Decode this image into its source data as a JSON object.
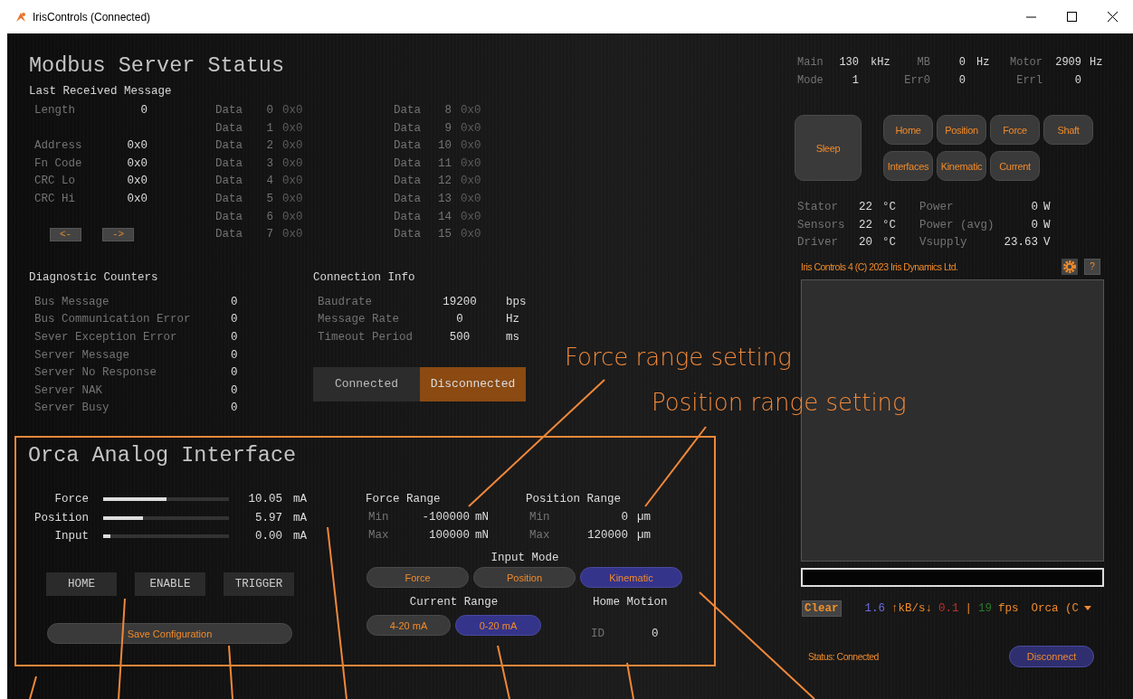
{
  "window": {
    "title": "IrisControls (Connected)"
  },
  "modbus": {
    "title": "Modbus Server Status",
    "last_message": {
      "heading": "Last Received Message",
      "length": {
        "label": "Length",
        "value": "0"
      },
      "fields": [
        {
          "label": "Address",
          "value": "0x0"
        },
        {
          "label": "Fn Code",
          "value": "0x0"
        },
        {
          "label": "CRC Lo",
          "value": "0x0"
        },
        {
          "label": "CRC Hi",
          "value": "0x0"
        }
      ],
      "nav_buttons": [
        "<-",
        "->"
      ],
      "data": [
        {
          "label": "Data",
          "index": "0",
          "value": "0x0"
        },
        {
          "label": "Data",
          "index": "1",
          "value": "0x0"
        },
        {
          "label": "Data",
          "index": "2",
          "value": "0x0"
        },
        {
          "label": "Data",
          "index": "3",
          "value": "0x0"
        },
        {
          "label": "Data",
          "index": "4",
          "value": "0x0"
        },
        {
          "label": "Data",
          "index": "5",
          "value": "0x0"
        },
        {
          "label": "Data",
          "index": "6",
          "value": "0x0"
        },
        {
          "label": "Data",
          "index": "7",
          "value": "0x0"
        },
        {
          "label": "Data",
          "index": "8",
          "value": "0x0"
        },
        {
          "label": "Data",
          "index": "9",
          "value": "0x0"
        },
        {
          "label": "Data",
          "index": "10",
          "value": "0x0"
        },
        {
          "label": "Data",
          "index": "11",
          "value": "0x0"
        },
        {
          "label": "Data",
          "index": "12",
          "value": "0x0"
        },
        {
          "label": "Data",
          "index": "13",
          "value": "0x0"
        },
        {
          "label": "Data",
          "index": "14",
          "value": "0x0"
        },
        {
          "label": "Data",
          "index": "15",
          "value": "0x0"
        }
      ]
    },
    "diagnostics": {
      "heading": "Diagnostic Counters",
      "rows": [
        {
          "label": "Bus Message",
          "value": "0"
        },
        {
          "label": "Bus Communication Error",
          "value": "0"
        },
        {
          "label": "Sever Exception Error",
          "value": "0"
        },
        {
          "label": "Server Message",
          "value": "0"
        },
        {
          "label": "Server No Response",
          "value": "0"
        },
        {
          "label": "Server NAK",
          "value": "0"
        },
        {
          "label": "Server Busy",
          "value": "0"
        }
      ]
    },
    "connection": {
      "heading": "Connection Info",
      "rows": [
        {
          "label": "Baudrate",
          "value": "19200",
          "unit": "bps"
        },
        {
          "label": "Message Rate",
          "value": "0",
          "unit": "Hz"
        },
        {
          "label": "Timeout Period",
          "value": "500",
          "unit": "ms"
        }
      ],
      "toggle": [
        {
          "label": "Connected",
          "selected": false
        },
        {
          "label": "Disconnected",
          "selected": true
        }
      ]
    }
  },
  "analog": {
    "title": "Orca Analog Interface",
    "signals": [
      {
        "label": "Force",
        "level": 0.5,
        "value": "10.05",
        "unit": "mA"
      },
      {
        "label": "Position",
        "level": 0.32,
        "value": "5.97",
        "unit": "mA"
      },
      {
        "label": "Input",
        "level": 0.06,
        "value": "0.00",
        "unit": "mA"
      }
    ],
    "buttons": [
      "HOME",
      "ENABLE",
      "TRIGGER"
    ],
    "save": "Save Configuration",
    "force_range": {
      "heading": "Force Range",
      "rows": [
        {
          "label": "Min",
          "value": "-100000",
          "unit": "mN"
        },
        {
          "label": "Max",
          "value": "100000",
          "unit": "mN"
        }
      ]
    },
    "position_range": {
      "heading": "Position Range",
      "rows": [
        {
          "label": "Min",
          "value": "0",
          "unit": "µm"
        },
        {
          "label": "Max",
          "value": "120000",
          "unit": "µm"
        }
      ]
    },
    "input_mode": {
      "heading": "Input Mode",
      "options": [
        {
          "label": "Force",
          "selected": false
        },
        {
          "label": "Position",
          "selected": false
        },
        {
          "label": "Kinematic",
          "selected": true
        }
      ]
    },
    "current_range": {
      "heading": "Current Range",
      "options": [
        {
          "label": "4-20 mA",
          "selected": false
        },
        {
          "label": "0-20 mA",
          "selected": true
        }
      ]
    },
    "home_motion": {
      "heading": "Home Motion",
      "label": "ID",
      "value": "0"
    }
  },
  "rates": [
    [
      {
        "label": "Main",
        "value": "130",
        "unit": "kHz"
      },
      {
        "label": "MB",
        "value": "0",
        "unit": "Hz"
      },
      {
        "label": "Motor",
        "value": "2909",
        "unit": "Hz"
      }
    ],
    [
      {
        "label": "Mode",
        "value": "1"
      },
      {
        "label": "Err0",
        "value": "0"
      },
      {
        "label": "Errl",
        "value": "0"
      }
    ]
  ],
  "modes": {
    "sleep": "Sleep",
    "buttons": [
      "Home",
      "Position",
      "Force",
      "Shaft",
      "Interfaces",
      "Kinematic",
      "Current"
    ]
  },
  "sensors": [
    {
      "label": "Stator",
      "value": "22",
      "unit": "°C",
      "label2": "Power",
      "value2": "0",
      "unit2": "W"
    },
    {
      "label": "Sensors",
      "value": "22",
      "unit": "°C",
      "label2": "Power (avg)",
      "value2": "0",
      "unit2": "W"
    },
    {
      "label": "Driver",
      "value": "20",
      "unit": "°C",
      "label2": "Vsupply",
      "value2": "23.63",
      "unit2": "V"
    }
  ],
  "footer": {
    "copyright": "Iris Controls 4 (C) 2023 Iris Dynamics Ltd.",
    "help": "?"
  },
  "console": {
    "clear": "Clear",
    "tx": "1.6",
    "units": "↑kB/s↓",
    "rx": "0.1",
    "separator": "|",
    "fps": "19",
    "fps_label": "fps",
    "device": "Orca (C"
  },
  "status": {
    "text": "Status: Connected",
    "button": "Disconnect"
  },
  "annotations": {
    "labels": [
      "Force range setting",
      "Position range setting"
    ]
  }
}
